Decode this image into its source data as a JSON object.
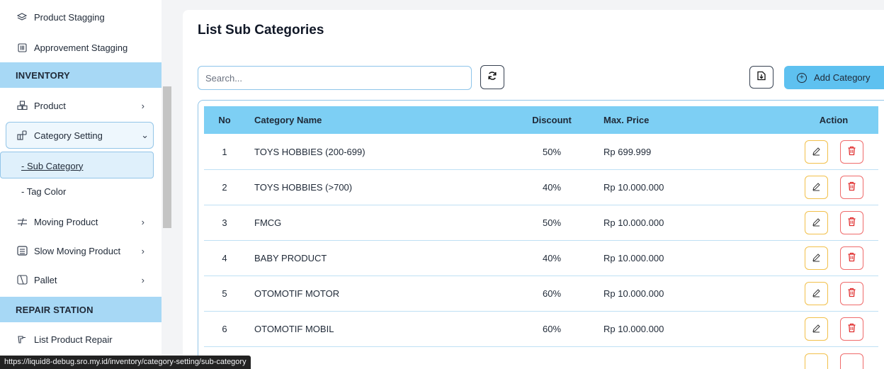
{
  "sidebar": {
    "items_top": [
      {
        "label": "Product Stagging",
        "icon": "layers-icon"
      },
      {
        "label": "Approvement Stagging",
        "icon": "columns-icon"
      }
    ],
    "inventory_section": "INVENTORY",
    "inventory_items": [
      {
        "label": "Product",
        "icon": "boxes-icon"
      },
      {
        "label": "Category Setting",
        "icon": "category-icon"
      },
      {
        "label": "- Sub Category"
      },
      {
        "label": "- Tag Color"
      },
      {
        "label": "Moving Product",
        "icon": "transfer-icon"
      },
      {
        "label": "Slow Moving Product",
        "icon": "archive-icon"
      },
      {
        "label": "Pallet",
        "icon": "pallet-icon"
      }
    ],
    "repair_section": "REPAIR STATION",
    "repair_items": [
      {
        "label": "List Product Repair",
        "icon": "wrench-icon"
      }
    ]
  },
  "main": {
    "title": "List Sub Categories",
    "search_placeholder": "Search...",
    "add_button_label": "Add Category",
    "table": {
      "headers": [
        "No",
        "Category Name",
        "Discount",
        "Max. Price",
        "Action"
      ],
      "rows": [
        {
          "no": "1",
          "name": "TOYS HOBBIES (200-699)",
          "discount": "50%",
          "max_price": "Rp 699.999"
        },
        {
          "no": "2",
          "name": "TOYS HOBBIES (>700)",
          "discount": "40%",
          "max_price": "Rp 10.000.000"
        },
        {
          "no": "3",
          "name": "FMCG",
          "discount": "50%",
          "max_price": "Rp 10.000.000"
        },
        {
          "no": "4",
          "name": "BABY PRODUCT",
          "discount": "40%",
          "max_price": "Rp 10.000.000"
        },
        {
          "no": "5",
          "name": "OTOMOTIF MOTOR",
          "discount": "60%",
          "max_price": "Rp 10.000.000"
        },
        {
          "no": "6",
          "name": "OTOMOTIF MOBIL",
          "discount": "60%",
          "max_price": "Rp 10.000.000"
        }
      ]
    }
  },
  "status_url": "https://liquid8-debug.sro.my.id/inventory/category-setting/sub-category",
  "colors": {
    "section_bg": "#a7d8f5",
    "table_header_bg": "#7dcff4",
    "primary_button": "#5ec1f0",
    "edit_border": "#f2c04b",
    "delete_border": "#ef6b6b"
  }
}
